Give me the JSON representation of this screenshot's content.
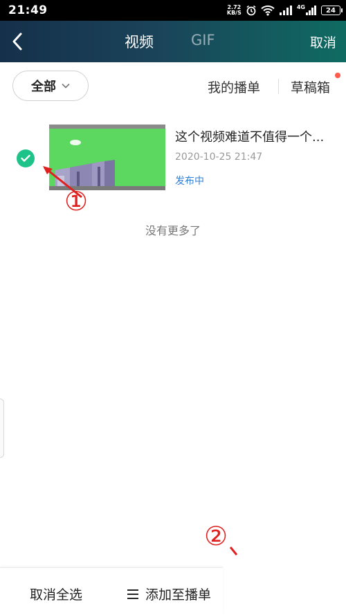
{
  "status_bar": {
    "time": "21:49",
    "net_speed_value": "2.72",
    "net_speed_unit": "KB/S",
    "network_type": "4G",
    "battery": "24"
  },
  "header": {
    "tabs": [
      "视频",
      "GIF"
    ],
    "active_tab": "视频",
    "cancel_label": "取消",
    "colors": {
      "gradient_start": "#15304a",
      "gradient_end": "#0f6b62"
    }
  },
  "filter": {
    "dropdown_label": "全部",
    "my_playlist_label": "我的播单",
    "drafts_label": "草稿箱",
    "has_draft_badge": true
  },
  "video": {
    "title": "这个视频难道不值得一个...",
    "date": "2020-10-25 21:47",
    "status": "发布中",
    "selected": true,
    "colors": {
      "check": "#1ec38a",
      "status": "#2f7fd6",
      "thumbnail_bg": "#5cd860"
    }
  },
  "list_end_text": "没有更多了",
  "annotations": {
    "marker_1": "①",
    "marker_2": "②",
    "color": "#e0201f"
  },
  "bottom_bar": {
    "deselect_all_label": "取消全选",
    "add_to_playlist_label": "添加至播单"
  }
}
